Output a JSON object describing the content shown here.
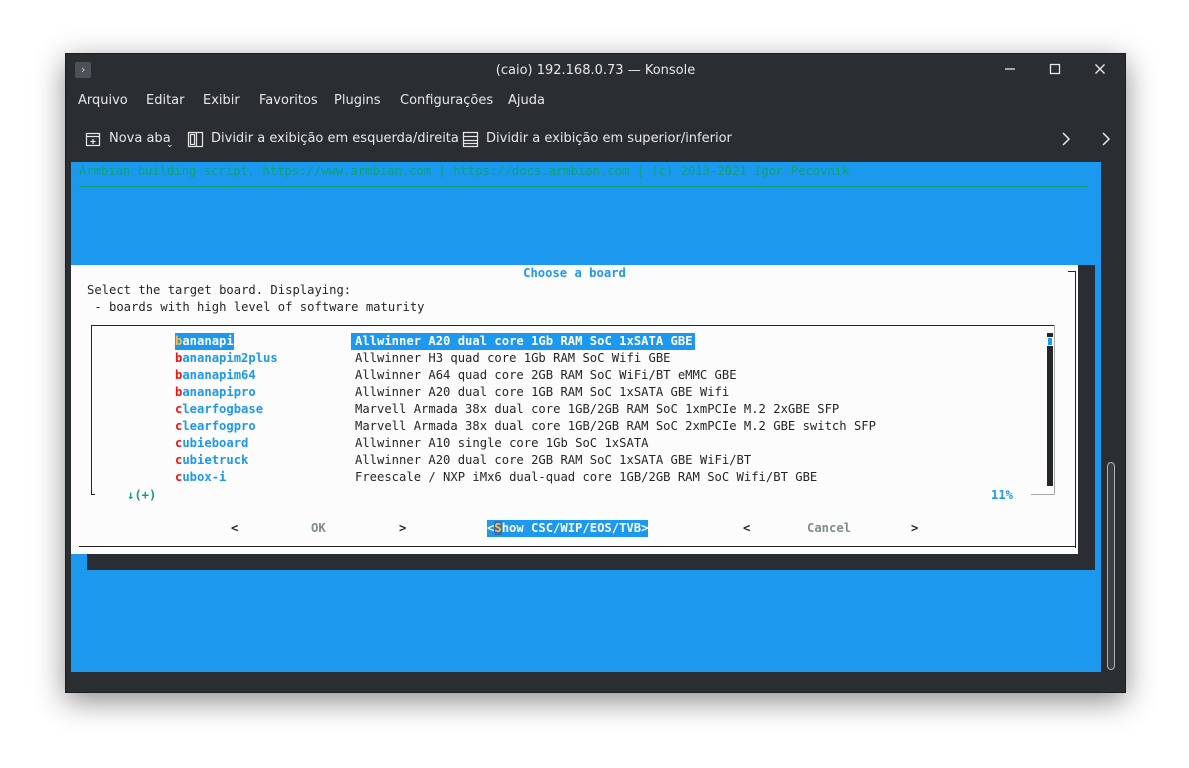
{
  "window": {
    "title": "(caio) 192.168.0.73 — Konsole",
    "app_icon": "terminal-icon",
    "controls": [
      "minimize-icon",
      "maximize-icon",
      "close-icon"
    ]
  },
  "menubar": {
    "items": [
      "Arquivo",
      "Editar",
      "Exibir",
      "Favoritos",
      "Plugins",
      "Configurações",
      "Ajuda"
    ]
  },
  "toolbar": {
    "new_tab": "Nova aba",
    "split_lr": "Dividir a exibição em esquerda/direita",
    "split_tb": "Dividir a exibição em superior/inferior"
  },
  "terminal": {
    "header": "Armbian building script, https://www.armbian.com | https://docs.armbian.com | (c) 2013-2021 Igor Pecovnik",
    "dialog": {
      "title": "Choose a board",
      "line1": "Select the target board. Displaying:",
      "line2": " - boards with high level of software maturity",
      "more_indicator": "↓(+)",
      "percent": "11%",
      "buttons": {
        "ok": "OK",
        "show": "Show CSC/WIP/EOS/TVB",
        "cancel": "Cancel",
        "lt": "<",
        "gt": ">"
      },
      "boards": [
        {
          "tag_first": "b",
          "tag_rest": "ananapi",
          "desc": "Allwinner A20 dual core 1Gb RAM SoC 1xSATA GBE"
        },
        {
          "tag_first": "b",
          "tag_rest": "ananapim2plus",
          "desc": "Allwinner H3 quad core 1Gb RAM SoC Wifi GBE"
        },
        {
          "tag_first": "b",
          "tag_rest": "ananapim64",
          "desc": "Allwinner A64 quad core 2GB RAM SoC WiFi/BT eMMC GBE"
        },
        {
          "tag_first": "b",
          "tag_rest": "ananapipro",
          "desc": "Allwinner A20 dual core 1GB RAM SoC 1xSATA GBE Wifi"
        },
        {
          "tag_first": "c",
          "tag_rest": "learfogbase",
          "desc": "Marvell Armada 38x dual core 1GB/2GB RAM SoC 1xmPCIe M.2 2xGBE SFP"
        },
        {
          "tag_first": "c",
          "tag_rest": "learfogpro",
          "desc": "Marvell Armada 38x dual core 1GB/2GB RAM SoC 2xmPCIe M.2 GBE switch SFP"
        },
        {
          "tag_first": "c",
          "tag_rest": "ubieboard",
          "desc": "Allwinner A10 single core 1Gb SoC 1xSATA"
        },
        {
          "tag_first": "c",
          "tag_rest": "ubietruck",
          "desc": "Allwinner A20 dual core 2GB RAM SoC 1xSATA GBE WiFi/BT"
        },
        {
          "tag_first": "c",
          "tag_rest": "ubox-i",
          "desc": "Freescale / NXP iMx6 dual-quad core 1GB/2GB RAM SoC Wifi/BT GBE"
        }
      ]
    }
  },
  "colors": {
    "terminal_bg": "#1c99ef",
    "dialog_bg": "#fcfcfc",
    "hotkey": "#ed1515",
    "selected_hotkey": "#fdbc4b",
    "header_text": "#11a07a"
  }
}
